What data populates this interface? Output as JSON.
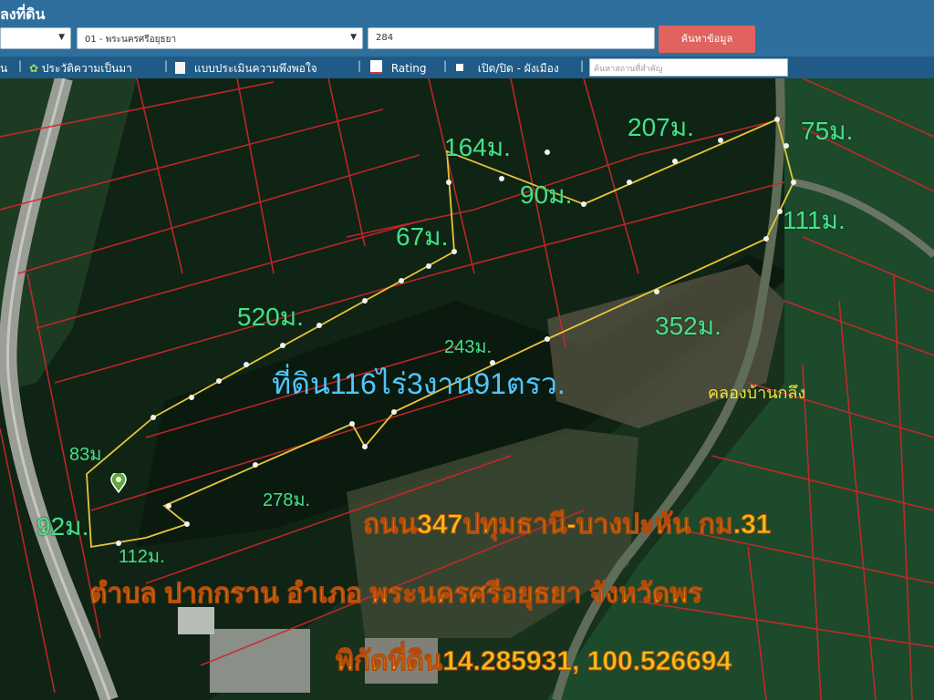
{
  "header": {
    "title": "ลงที่ดิน",
    "amphoe_select": "01 - พระนครศรีอยุธยา",
    "parcel_input": "284",
    "search_button": "ค้นหาข้อมูล"
  },
  "toolbar": {
    "items": [
      "น",
      "ประวัติความเป็นมา",
      "แบบประเมินความพึงพอใจ",
      "Rating",
      "เปิด/ปิด - ผังเมือง"
    ],
    "search_placeholder": "ค้นหาสถานที่สำคัญ"
  },
  "map": {
    "distances": [
      "164ม.",
      "207ม.",
      "75ม.",
      "90ม.",
      "111ม.",
      "67ม.",
      "520ม.",
      "352ม.",
      "243ม.",
      "83ม.",
      "278ม.",
      "92ม.",
      "112ม."
    ],
    "area_label": "ที่ดิน116ไร่3งาน91ตรว.",
    "canal_label": "คลองบ้านกลึง",
    "road_label": "ถนน347ปทุมธานี-บางปะหัน กม.31",
    "location_label": "ตำบล ปากกราน อำเภอ พระนครศรีอยุธยา จังหวัดพร",
    "coords_label": "พิกัดที่ดิน14.285931, 100.526694"
  },
  "colors": {
    "header": "#2f6f9e",
    "toolbar": "#1f5b86",
    "distance": "#46e088",
    "area": "#4fc6ff",
    "canal": "#f2e23a",
    "big_text": "#f2c018"
  }
}
